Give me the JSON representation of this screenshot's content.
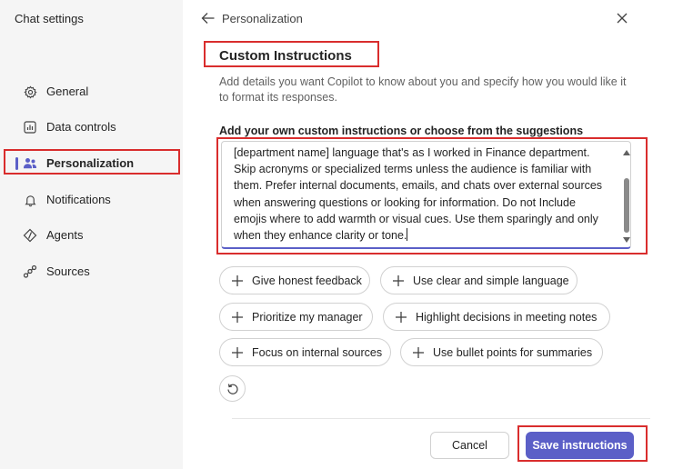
{
  "sidebar": {
    "title": "Chat settings",
    "items": [
      {
        "label": "General",
        "icon": "gear-icon"
      },
      {
        "label": "Data controls",
        "icon": "chart-icon"
      },
      {
        "label": "Personalization",
        "icon": "people-icon",
        "active": true
      },
      {
        "label": "Notifications",
        "icon": "bell-icon"
      },
      {
        "label": "Agents",
        "icon": "agents-icon"
      },
      {
        "label": "Sources",
        "icon": "sources-icon"
      }
    ]
  },
  "header": {
    "title": "Personalization",
    "back_icon": "arrow-left-icon",
    "close_icon": "close-icon"
  },
  "section": {
    "title": "Custom Instructions",
    "description": "Add details you want Copilot to know about you and specify how you would like it to format its responses."
  },
  "instructions": {
    "label": "Add your own custom instructions or choose from the suggestions",
    "value": "[department name] language that's as I worked in Finance department. Skip acronyms or specialized terms unless the audience is familiar with them. Prefer internal documents, emails, and chats over external sources when answering questions or looking for information. Do not Include emojis where to add warmth or visual cues. Use them sparingly and only when they enhance clarity or tone."
  },
  "suggestions": [
    "Give honest feedback",
    "Use clear and simple language",
    "Prioritize my manager",
    "Highlight decisions in meeting notes",
    "Focus on internal sources",
    "Use bullet points for summaries"
  ],
  "footer": {
    "cancel_label": "Cancel",
    "save_label": "Save instructions"
  },
  "colors": {
    "accent": "#5b5fc7",
    "highlight": "#d92d2d",
    "sidebar_bg": "#f5f5f5"
  }
}
